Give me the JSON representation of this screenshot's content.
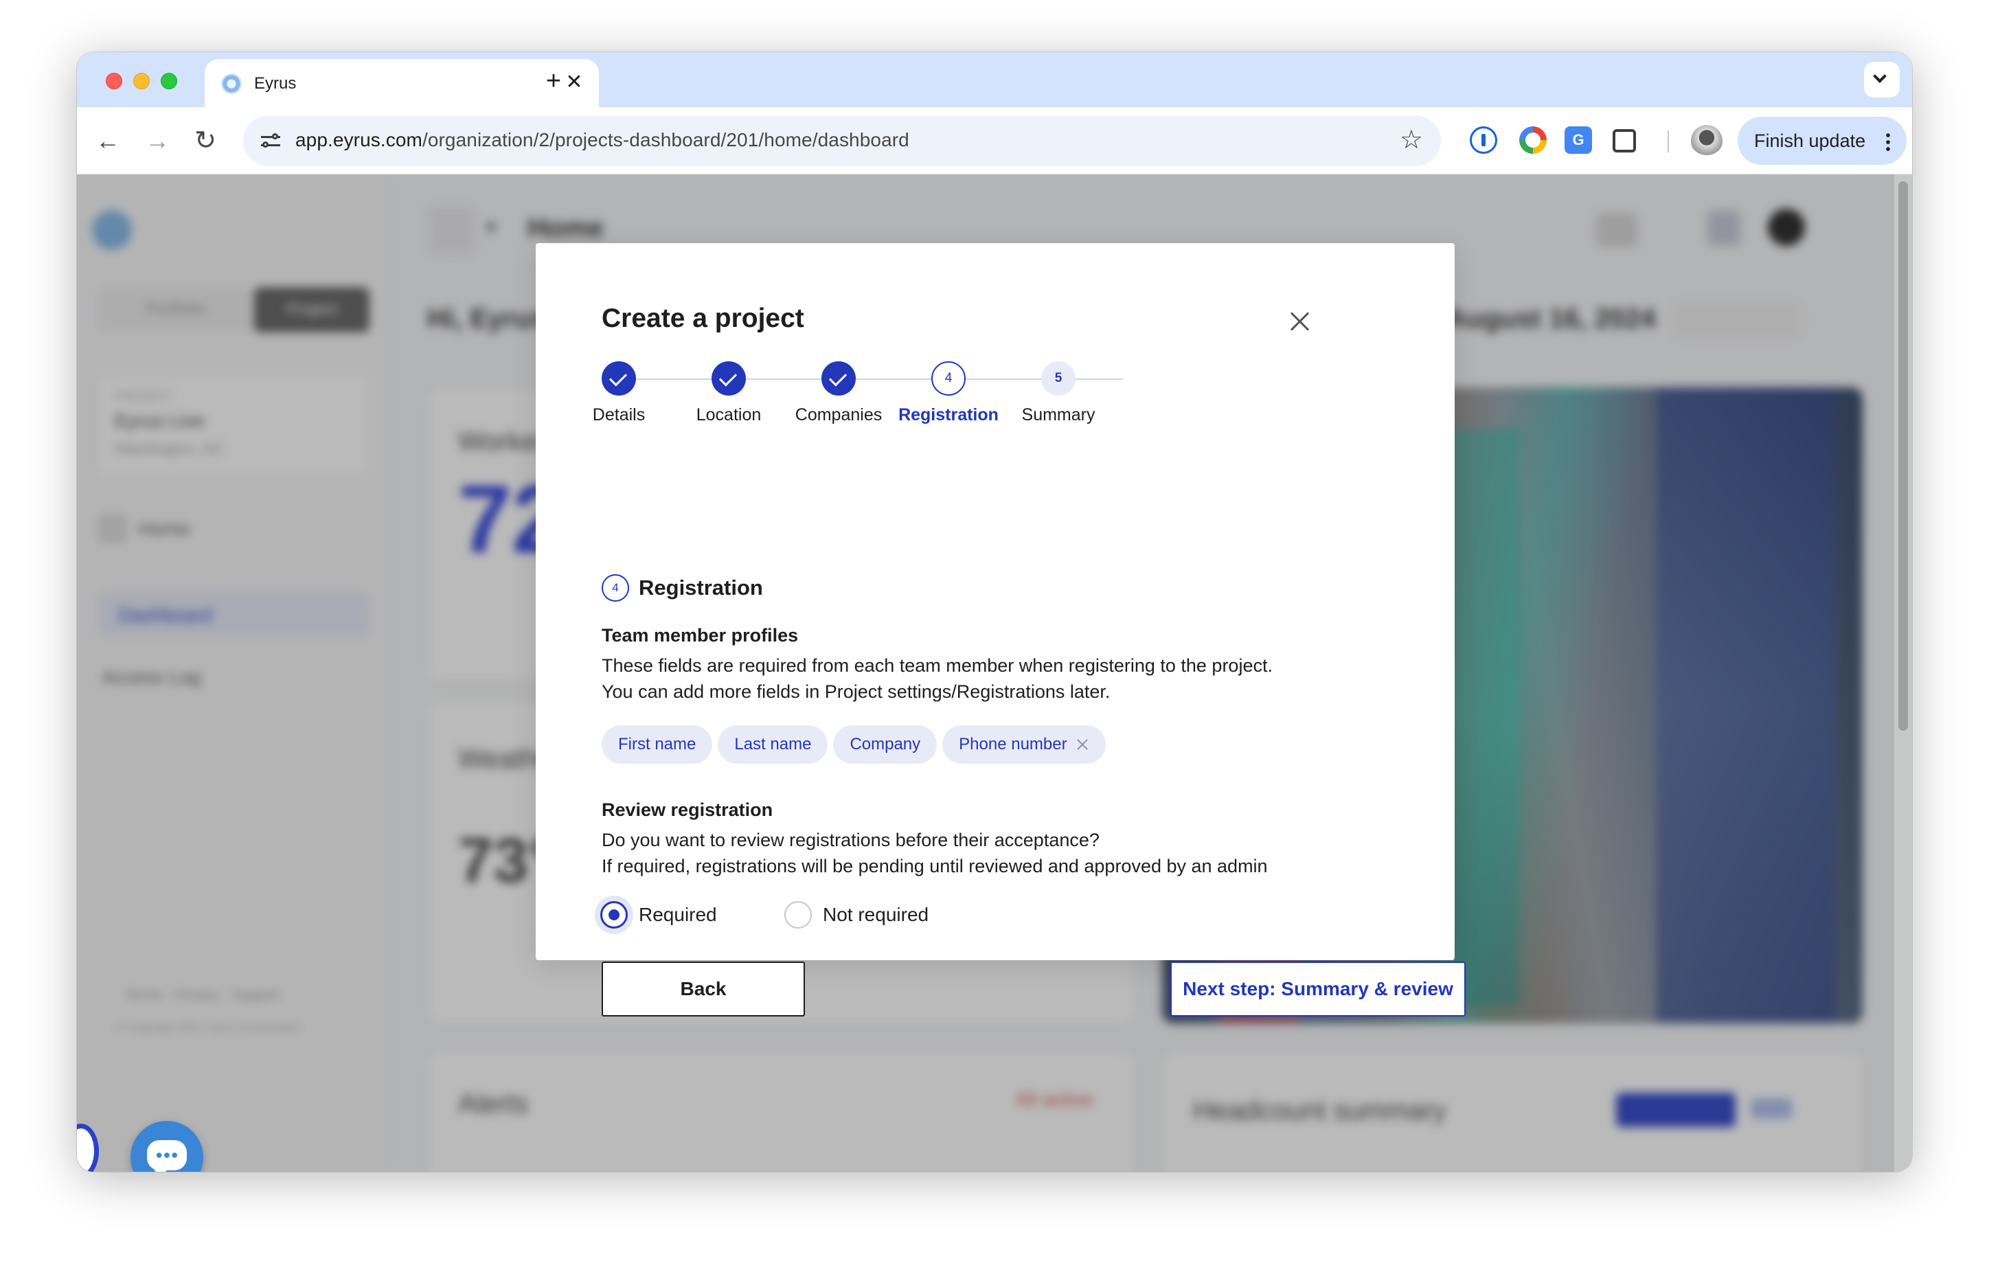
{
  "browser": {
    "tab_title": "Eyrus",
    "tab_close": "✕",
    "new_tab": "+",
    "url_host": "app.eyrus.com",
    "url_path": "/organization/2/projects-dashboard/201/home/dashboard",
    "back": "←",
    "forward": "→",
    "reload": "↻",
    "bookmark": "☆",
    "translate_ext": "G",
    "finish_update": "Finish update"
  },
  "sidebar": {
    "switch": [
      "Portfolio",
      "Project"
    ],
    "project_caption": "PROJECT",
    "project_name": "Eyrus Live",
    "project_location": "Washington, DC",
    "items": [
      "Home",
      "Dashboard",
      "Access Log"
    ],
    "footer": "Terms · Privacy · Support",
    "copyright": "© Copyright 2024, Eyrus Incorporated"
  },
  "header": {
    "title": "Home",
    "greeting": "Hi, Eyrus",
    "date": "August 16, 2024"
  },
  "cards": {
    "workers_title": "Workers",
    "workers_value": "72",
    "weather_title": "Weather",
    "weather_value": "73°",
    "alerts_title": "Alerts",
    "alerts_badge": "All active",
    "headcount_title": "Headcount summary"
  },
  "modal": {
    "title": "Create a project",
    "steps": [
      {
        "label": "Details",
        "state": "done"
      },
      {
        "label": "Location",
        "state": "done"
      },
      {
        "label": "Companies",
        "state": "done"
      },
      {
        "label": "Registration",
        "state": "current",
        "number": "4"
      },
      {
        "label": "Summary",
        "state": "todo",
        "number": "5"
      }
    ],
    "section_number": "4",
    "section_title": "Registration",
    "team_profiles_title": "Team member profiles",
    "team_profiles_line1": "These fields are required from each team member when registering to the project.",
    "team_profiles_line2": "You can add more fields in Project settings/Registrations later.",
    "chips": [
      "First name",
      "Last name",
      "Company",
      "Phone number"
    ],
    "review_title": "Review registration",
    "review_line1": "Do you want to review registrations before their acceptance?",
    "review_line2": "If required, registrations will be pending until reviewed and approved by an admin",
    "radio_required": "Required",
    "radio_not_required": "Not required",
    "selected_option": "Required",
    "back_button": "Back",
    "next_button": "Next step: Summary & review"
  },
  "colors": {
    "accent": "#2237b9",
    "chip_bg": "#e8ebf7",
    "tabstrip": "#d3e3fd"
  }
}
